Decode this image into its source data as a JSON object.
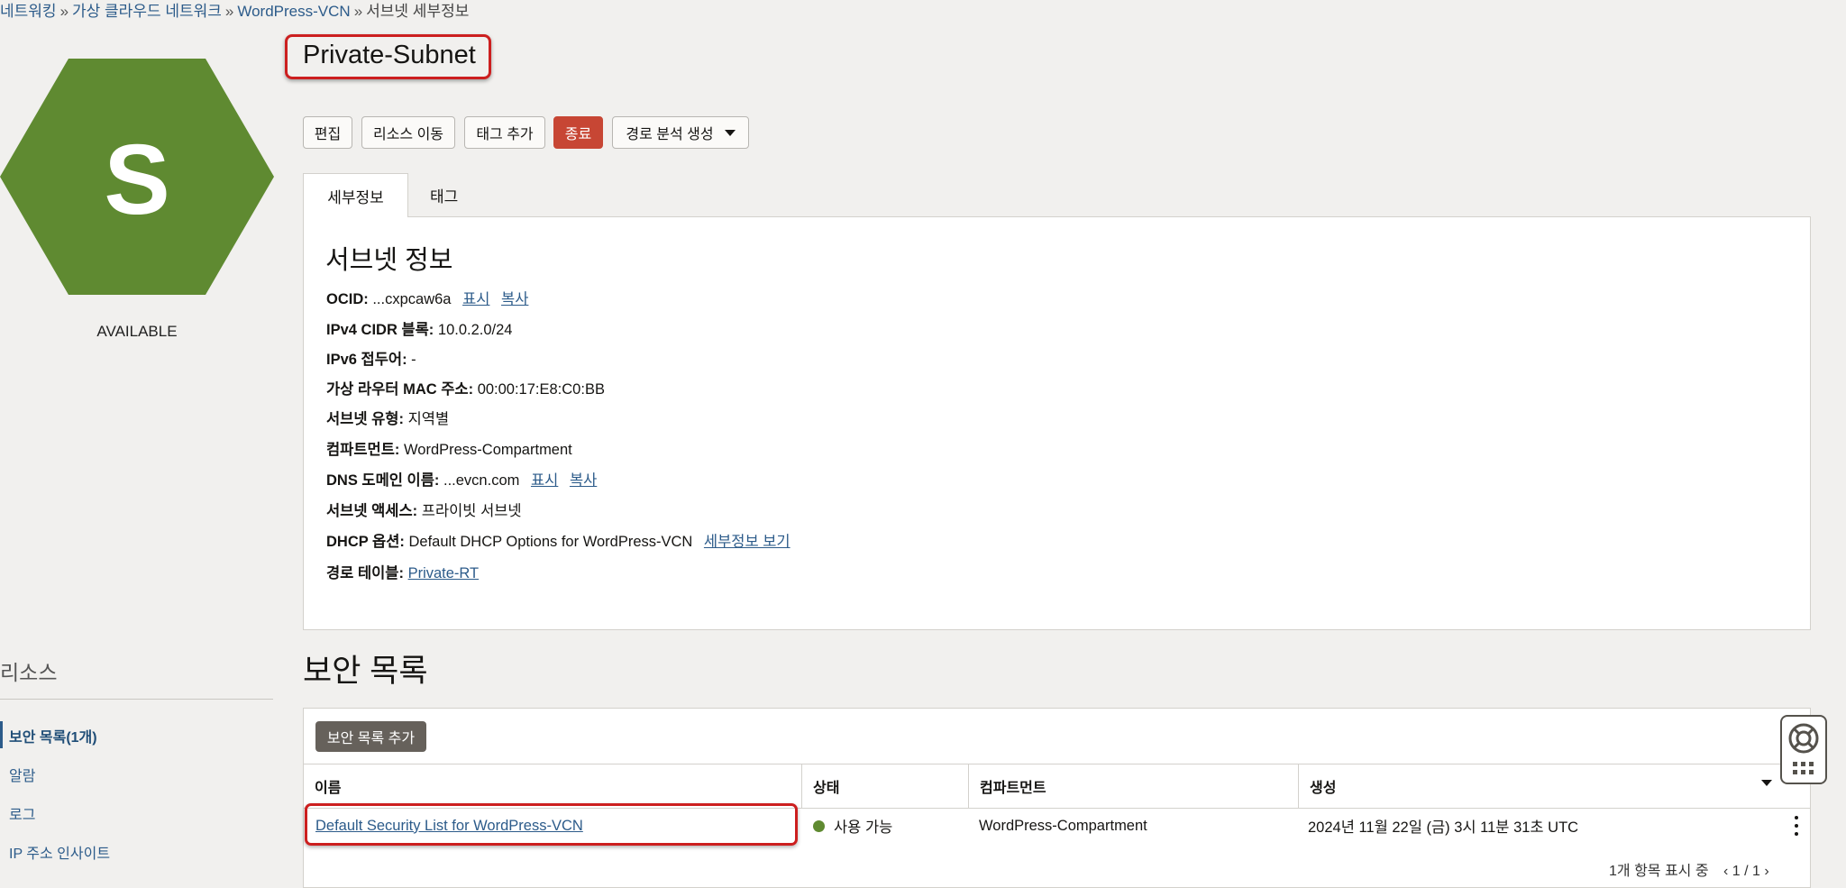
{
  "breadcrumb": {
    "items": [
      "네트워킹",
      "가상 클라우드 네트워크",
      "WordPress-VCN"
    ],
    "separator": "»",
    "current": "서브넷 세부정보"
  },
  "resource_icon": {
    "letter": "S",
    "color": "#5f8a31"
  },
  "status": "AVAILABLE",
  "title": "Private-Subnet",
  "actions": {
    "edit": "편집",
    "move": "리소스 이동",
    "add_tag": "태그 추가",
    "terminate": "종료",
    "path_analysis": "경로 분석 생성"
  },
  "tabs": {
    "details": "세부정보",
    "tags": "태그"
  },
  "subnet_info": {
    "heading": "서브넷 정보",
    "ocid_label": "OCID:",
    "ocid_value": "...cxpcaw6a",
    "show": "표시",
    "copy": "복사",
    "ipv4_label": "IPv4 CIDR 블록:",
    "ipv4_value": "10.0.2.0/24",
    "ipv6_label": "IPv6 접두어:",
    "ipv6_value": "-",
    "mac_label": "가상 라우터 MAC 주소:",
    "mac_value": "00:00:17:E8:C0:BB",
    "type_label": "서브넷 유형:",
    "type_value": "지역별",
    "compartment_label": "컴파트먼트:",
    "compartment_value": "WordPress-Compartment",
    "dns_label": "DNS 도메인 이름:",
    "dns_value": "...evcn.com",
    "access_label": "서브넷 액세스:",
    "access_value": "프라이빗 서브넷",
    "dhcp_label": "DHCP 옵션:",
    "dhcp_value": "Default DHCP Options for WordPress-VCN",
    "dhcp_link": "세부정보 보기",
    "route_label": "경로 테이블:",
    "route_value": "Private-RT"
  },
  "resources": {
    "title": "리소스",
    "items": [
      "보안 목록(1개)",
      "알람",
      "로그",
      "IP 주소 인사이트"
    ]
  },
  "security_lists": {
    "title": "보안 목록",
    "add_button": "보안 목록 추가",
    "columns": [
      "이름",
      "상태",
      "컴파트먼트",
      "생성"
    ],
    "rows": [
      {
        "name": "Default Security List for WordPress-VCN",
        "status": "사용 가능",
        "compartment": "WordPress-Compartment",
        "created": "2024년 11월 22일 (금) 3시 11분 31초 UTC"
      }
    ],
    "footer": "1개 항목 표시 중",
    "pagination": "1 / 1"
  },
  "colors": {
    "link": "#2c5b8a",
    "danger": "#c74634",
    "highlight": "#cc1f1f",
    "available": "#5f8a31"
  }
}
